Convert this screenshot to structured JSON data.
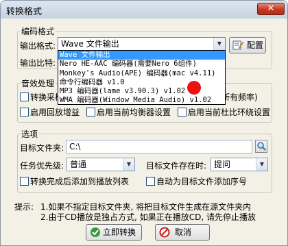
{
  "window": {
    "title": "转换格式",
    "close_label": "✕"
  },
  "encoding": {
    "group_title": "编码格式",
    "output_format_label": "输出格式:",
    "selected_format": "Wave 文件输出",
    "config_button": "配置",
    "bitrate_label": "输出比特:",
    "dropdown_options": [
      "Wave 文件输出",
      "Nero HE-AAC 编码器(需要Nero 6组件)",
      "Monkey's Audio(APE) 编码器(mac v4.11)",
      "命令行编码器 v1.0",
      "MP3 编码器(lame v3.90.3) v1.02",
      "WMA 编码器(Window Media Audio) v1.02"
    ]
  },
  "effects": {
    "group_title": "音效处理",
    "resample_label": "转换采样",
    "resample_tail": "所有频率)",
    "playback_gain": "启用回放增益",
    "equalizer": "启用当前均衡器设置",
    "dolby": "启用当前杜比环绕设置"
  },
  "options": {
    "group_title": "选项",
    "target_folder_label": "目标文件夹:",
    "target_folder_value": "C:\\",
    "priority_label": "任务优先级:",
    "priority_value": "普通",
    "exists_label": "目标文件存在时:",
    "exists_value": "提问",
    "add_to_playlist": "转换完成后添加到播放列表",
    "add_serial": "自动为目标文件添加序号"
  },
  "tips": {
    "label": "提示:",
    "line1": "1.如果不指定目标文件夹, 将把目标文件生成在源文件夹内",
    "line2": "2.由于CD播放是独占方式, 如果正在播放CD, 请先停止播放"
  },
  "buttons": {
    "convert": "立即转换",
    "cancel": "取消"
  },
  "colors": {
    "selection": "#3399ff",
    "marker": "#ee1111",
    "window_bg": "#f3f0e6"
  }
}
